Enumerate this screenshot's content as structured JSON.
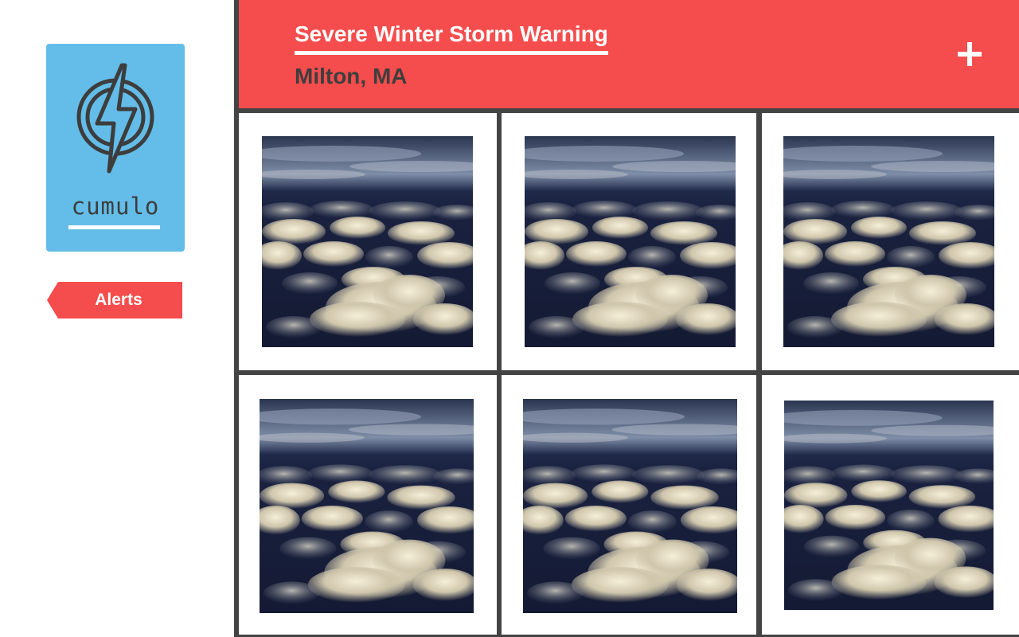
{
  "app": {
    "name": "cumulo"
  },
  "sidebar": {
    "logo_icon": "lightning-circle-icon",
    "nav": [
      {
        "label": "Alerts",
        "active": true
      }
    ]
  },
  "alert": {
    "title": "Severe Winter Storm Warning",
    "location": "Milton, MA",
    "add_icon": "plus-icon"
  },
  "gallery": {
    "photos": [
      {
        "subject": "clouds-photo"
      },
      {
        "subject": "clouds-photo"
      },
      {
        "subject": "clouds-photo"
      },
      {
        "subject": "clouds-photo"
      },
      {
        "subject": "clouds-photo"
      },
      {
        "subject": "clouds-photo"
      }
    ]
  },
  "colors": {
    "accent_red": "#f54d4d",
    "logo_blue": "#63bde8",
    "frame_dark": "#444444"
  }
}
